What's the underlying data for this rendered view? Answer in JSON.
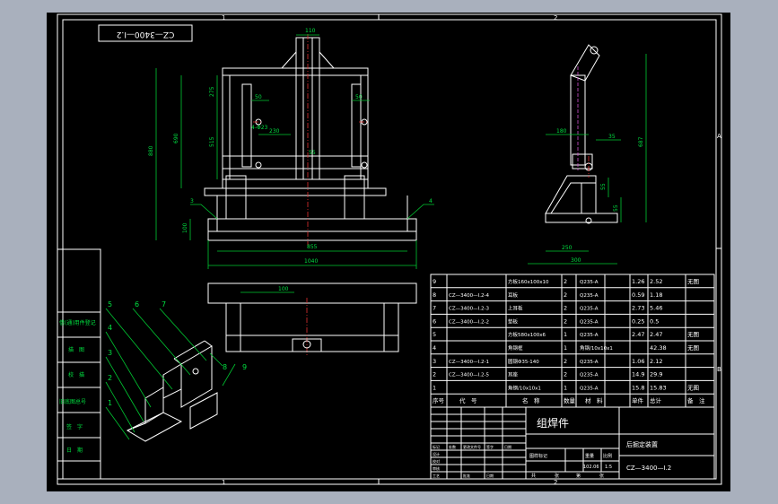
{
  "drawing": {
    "code_stamp": "CZ—3400—I.2",
    "zone_cols": [
      "1",
      "2"
    ],
    "zone_rows": [
      "A",
      "B"
    ],
    "assembly_name": "组焊件",
    "device_name": "后掘定装置",
    "drawing_code": "CZ—3400—I.2"
  },
  "colors": {
    "border": "#ffffff",
    "dimension": "#00c832",
    "table": "#ffffff",
    "hidden": "#d050d0",
    "center": "#e23030",
    "background": "#000000"
  },
  "front_dims": {
    "top_width": "110",
    "d50a": "50",
    "d50b": "50",
    "d275": "275",
    "d515": "515",
    "d880": "880",
    "d690": "690",
    "d230": "230",
    "d55": "55",
    "d100": "100",
    "d855": "855",
    "d1040": "1040",
    "hole_dia": "4-Φ23",
    "weld_left": "3",
    "weld_right": "4"
  },
  "side_dims": {
    "d180": "180",
    "d35": "35",
    "d687": "687",
    "d55": "55",
    "d55b": "55",
    "d250": "250",
    "d300": "300"
  },
  "top_dims": {
    "d100": "100"
  },
  "iso_callouts": [
    "5",
    "6",
    "7",
    "4",
    "3",
    "2",
    "1",
    "8",
    "9"
  ],
  "bom": {
    "header": {
      "no": "序号",
      "code": "代　号",
      "name": "名　称",
      "qty": "数量",
      "mat": "材　料",
      "unit_w": "单件",
      "total_w": "总计",
      "weight": "重　量",
      "note": "备　注"
    },
    "rows": [
      {
        "no": "9",
        "code": "",
        "name": "方板160x100x10",
        "qty": "2",
        "mat": "Q235-A",
        "unit_w": "1.26",
        "total_w": "2.52",
        "note": "无图"
      },
      {
        "no": "8",
        "code": "CZ—3400—I.2-4",
        "name": "耳板",
        "qty": "2",
        "mat": "Q235-A",
        "unit_w": "0.59",
        "total_w": "1.18",
        "note": ""
      },
      {
        "no": "7",
        "code": "CZ—3400—I.2-3",
        "name": "上耳板",
        "qty": "2",
        "mat": "Q235-A",
        "unit_w": "2.73",
        "total_w": "5.46",
        "note": ""
      },
      {
        "no": "6",
        "code": "CZ—3400—I.2-2",
        "name": "垫板",
        "qty": "2",
        "mat": "Q235-A",
        "unit_w": "0.25",
        "total_w": "0.5",
        "note": ""
      },
      {
        "no": "5",
        "code": "",
        "name": "方板580x100x6",
        "qty": "1",
        "mat": "Q235-A",
        "unit_w": "2.47",
        "total_w": "2.47",
        "note": "无图"
      },
      {
        "no": "4",
        "code": "",
        "name": "角钢框",
        "qty": "1",
        "mat": "角钢/10x10x1",
        "unit_w": "",
        "total_w": "42.38",
        "note": "无图"
      },
      {
        "no": "3",
        "code": "CZ—3400—I.2-1",
        "name": "圆钢Φ35-140",
        "qty": "2",
        "mat": "Q235-A",
        "unit_w": "1.06",
        "total_w": "2.12",
        "note": ""
      },
      {
        "no": "2",
        "code": "CZ—3400—I.2-5",
        "name": "耳座",
        "qty": "2",
        "mat": "Q235-A",
        "unit_w": "14.9",
        "total_w": "29.9",
        "note": ""
      },
      {
        "no": "1",
        "code": "",
        "name": "角钢/10x10x1",
        "qty": "1",
        "mat": "Q235-A",
        "unit_w": "15.8",
        "total_w": "15.83",
        "note": "无图"
      }
    ]
  },
  "side_panel": [
    "借(通)用件登记",
    "旧底图总号",
    "底图总号",
    "签　字",
    "日　期"
  ],
  "side_panel_top": "描　图",
  "side_panel_mid": "校　描",
  "title_block": {
    "stage_mark": "图样标记",
    "weight": "重量",
    "scale": "比例",
    "scale_value": "1:5",
    "weight_value": "102.06",
    "sheet": "共",
    "sheet2": "张",
    "sheet3": "第",
    "sheet4": "张",
    "labels": [
      "标记",
      "处数",
      "更改文件号",
      "签字",
      "日期"
    ],
    "roles": [
      "设计",
      "校对",
      "审核",
      "工艺",
      "标准",
      "批准"
    ],
    "date_label": "日期"
  }
}
